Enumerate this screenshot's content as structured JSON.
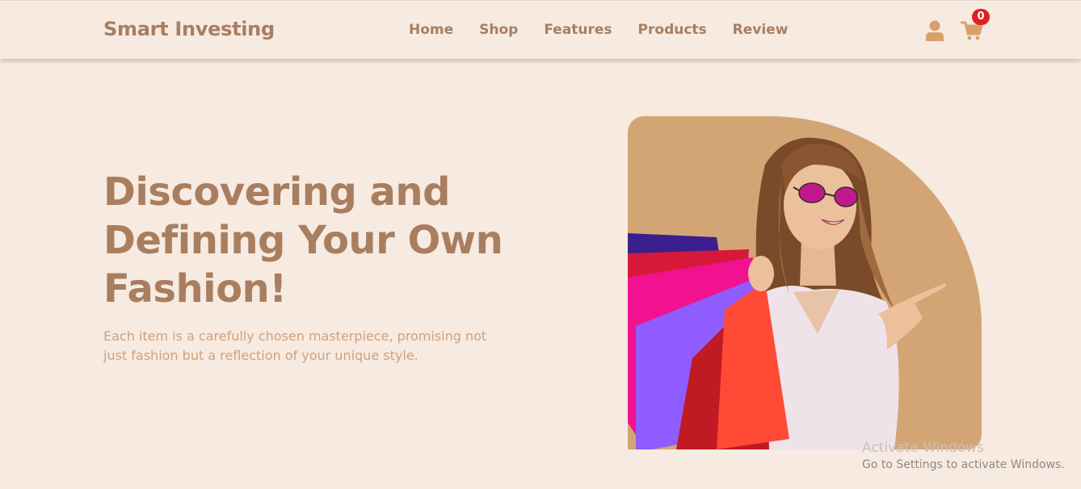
{
  "navbar": {
    "brand": "Smart Investing",
    "links": [
      "Home",
      "Shop",
      "Features",
      "Products",
      "Review"
    ],
    "cart_count": "0",
    "user_icon": "user-icon",
    "cart_icon": "shopping-cart-icon"
  },
  "hero": {
    "title_lines": [
      "Discovering and",
      "Defining Your Own",
      "Fashion!"
    ],
    "subtitle_lines": [
      "Each item is a carefully chosen masterpiece, promising not",
      "just fashion but a reflection of your unique style."
    ]
  },
  "watermark": {
    "title": "Activate Windows",
    "subtitle": "Go to Settings to activate Windows."
  },
  "colors": {
    "background": "#f6eae1",
    "accent": "#a97e5f",
    "subtitle": "#d2a17a",
    "image_backdrop": "#d4a574",
    "badge": "#e01f1f"
  }
}
